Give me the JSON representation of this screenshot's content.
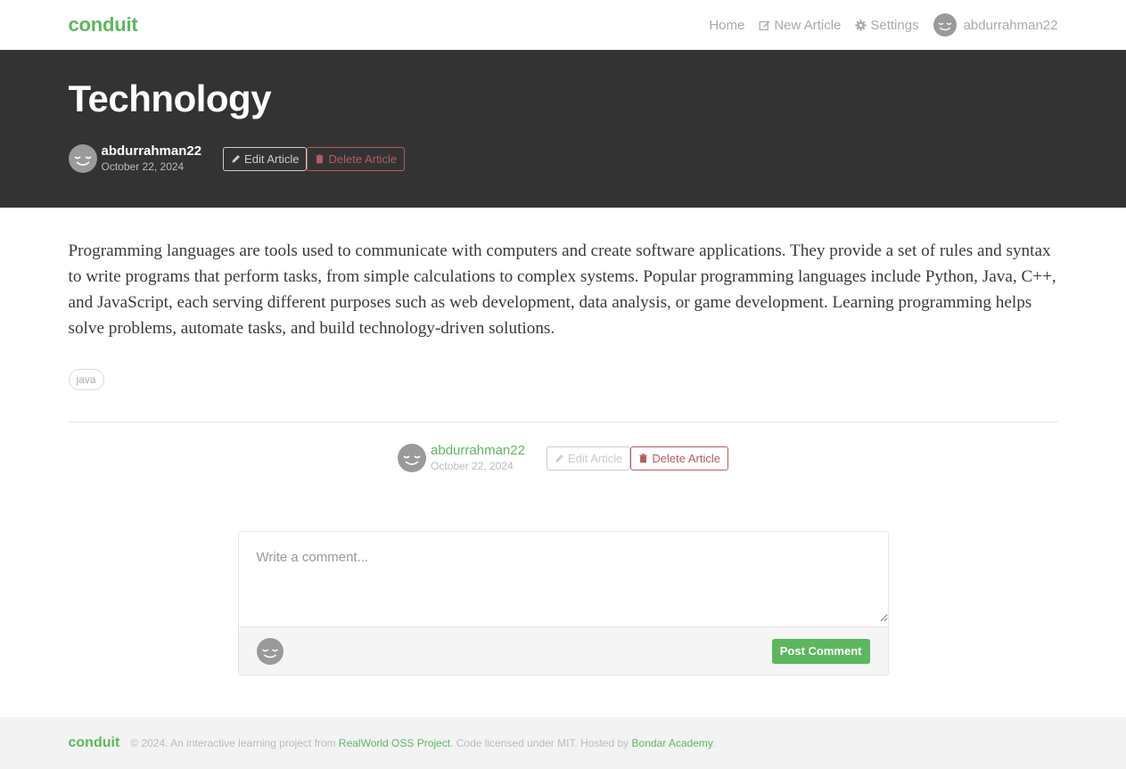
{
  "nav": {
    "brand": "conduit",
    "home": "Home",
    "new_article": "New Article",
    "settings": "Settings",
    "username": "abdurrahman22"
  },
  "banner": {
    "title": "Technology",
    "author": "abdurrahman22",
    "date": "October 22, 2024",
    "edit_label": "Edit Article",
    "delete_label": "Delete Article"
  },
  "article": {
    "body": "Programming languages are tools used to communicate with computers and create software applications. They provide a set of rules and syntax to write programs that perform tasks, from simple calculations to complex systems. Popular programming languages include Python, Java, C++, and JavaScript, each serving different purposes such as web development, data analysis, or game development. Learning programming helps solve problems, automate tasks, and build technology-driven solutions.",
    "tags": [
      "java"
    ]
  },
  "actions": {
    "author": "abdurrahman22",
    "date": "October 22, 2024",
    "edit_label": "Edit Article",
    "delete_label": "Delete Article"
  },
  "comment": {
    "placeholder": "Write a comment...",
    "value": "",
    "post_label": "Post Comment"
  },
  "footer": {
    "logo": "conduit",
    "text_before": "© 2024. An interactive learning project from",
    "link1": "RealWorld OSS Project",
    "text_middle": ". Code licensed under MIT. Hosted by",
    "link2": "Bondar Academy",
    "text_after": "."
  },
  "colors": {
    "brand": "#5cb85c",
    "banner_bg": "#333333",
    "danger": "#b85c5c"
  },
  "icons": [
    "pencil-square-icon",
    "gear-icon",
    "pencil-icon",
    "trash-icon",
    "avatar-smiley-icon"
  ]
}
